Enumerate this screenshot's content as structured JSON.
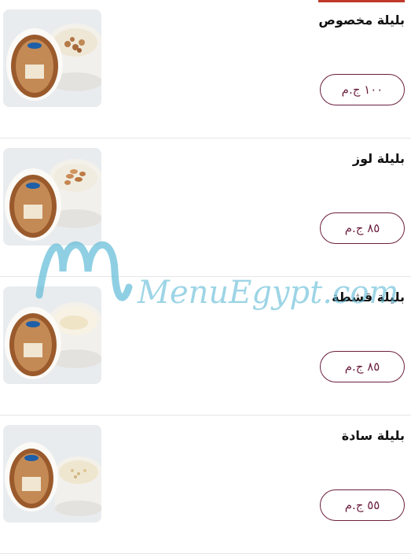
{
  "menu": {
    "items": [
      {
        "name": "بليلة مخصوص",
        "price": "١٠٠ ج.م",
        "image_icon": "bowl-with-nuts-icon"
      },
      {
        "name": "بليلة لوز",
        "price": "٨٥ ج.م",
        "image_icon": "bowl-with-almonds-icon"
      },
      {
        "name": "بليلة قشطة",
        "price": "٨٥ ج.م",
        "image_icon": "bowl-with-cream-icon"
      },
      {
        "name": "بليلة سادة",
        "price": "٥٥ ج.م",
        "image_icon": "bowl-plain-icon"
      }
    ]
  },
  "watermark": {
    "text": "MenuEgypt.com"
  },
  "colors": {
    "accent": "#6b1f3f",
    "top_bar": "#c0392b",
    "watermark": "#5bb8d6"
  }
}
